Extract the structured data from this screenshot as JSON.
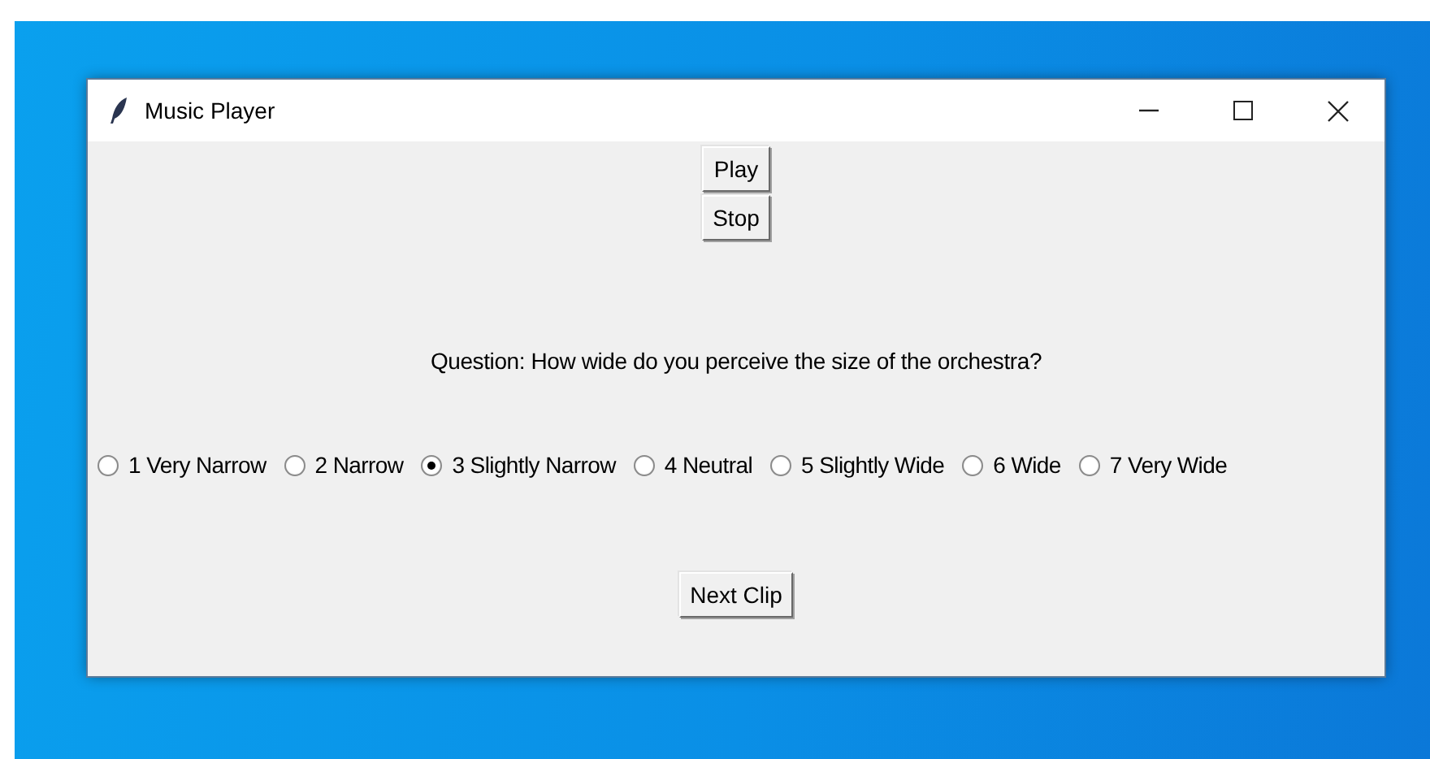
{
  "window": {
    "title": "Music Player"
  },
  "controls": [
    {
      "label": "Play"
    },
    {
      "label": "Stop"
    }
  ],
  "question": "Question: How wide do you perceive the size of the orchestra?",
  "options": [
    {
      "label": "1 Very Narrow",
      "selected": false
    },
    {
      "label": "2 Narrow",
      "selected": false
    },
    {
      "label": "3 Slightly Narrow",
      "selected": true
    },
    {
      "label": "4 Neutral",
      "selected": false
    },
    {
      "label": "5 Slightly Wide",
      "selected": false
    },
    {
      "label": "6 Wide",
      "selected": false
    },
    {
      "label": "7 Very Wide",
      "selected": false
    }
  ],
  "next_button": {
    "label": "Next Clip"
  }
}
